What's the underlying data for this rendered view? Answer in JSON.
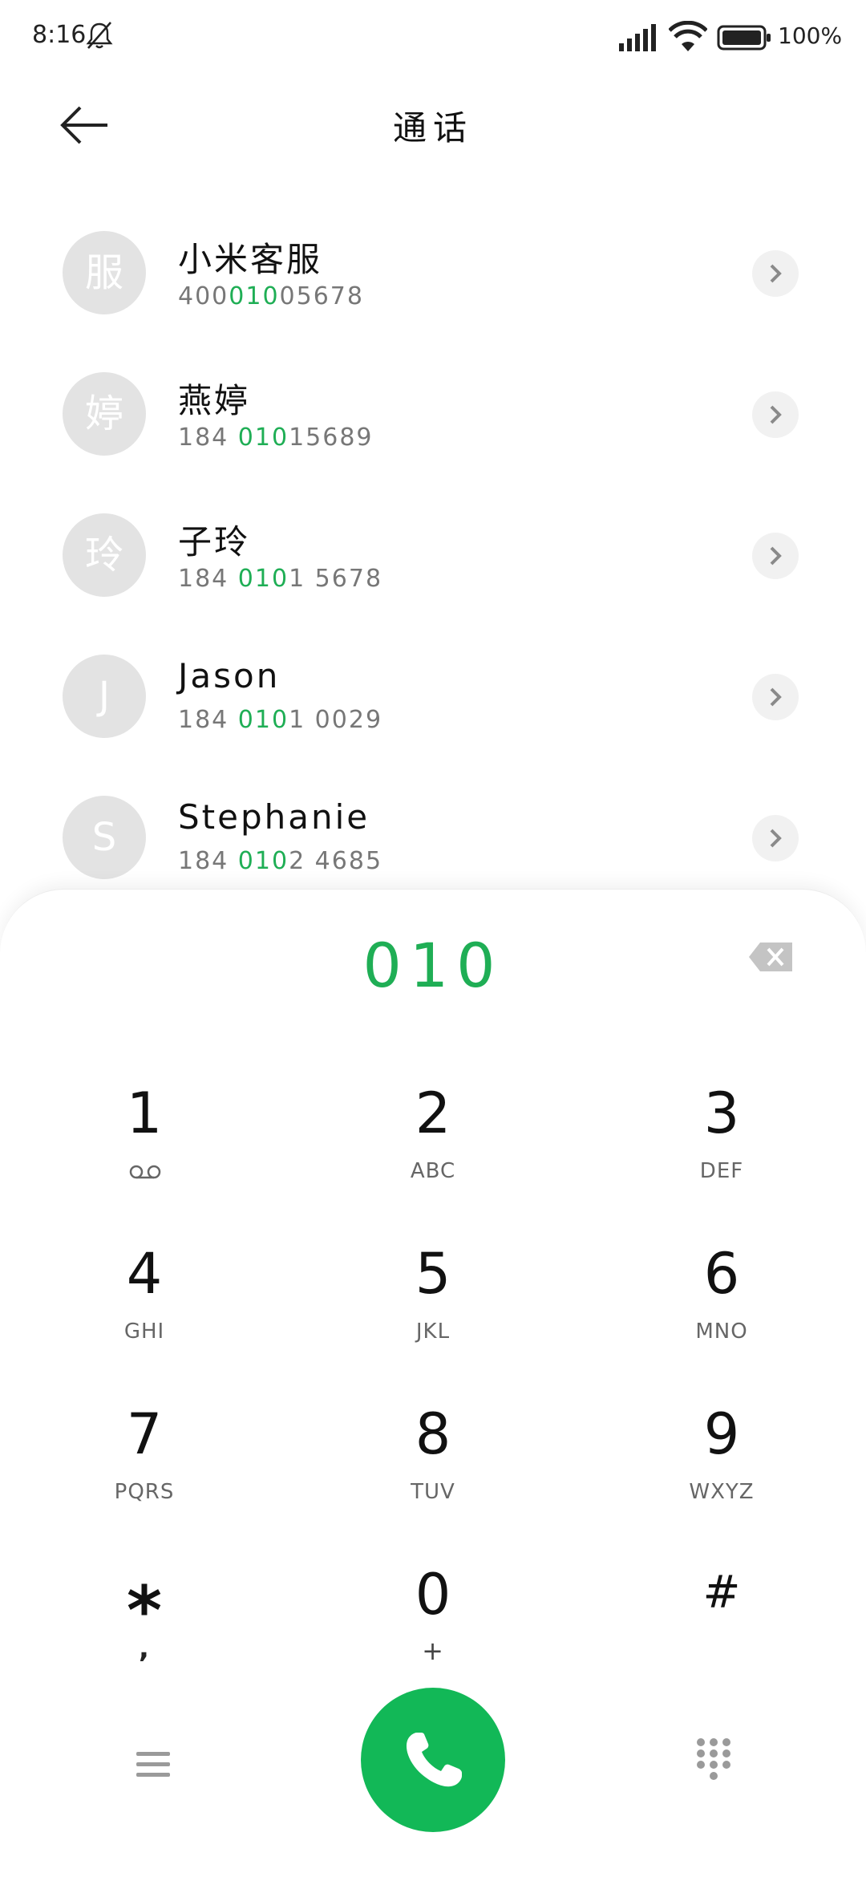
{
  "status_bar": {
    "time": "8:16",
    "battery": "100%"
  },
  "header": {
    "title": "通话"
  },
  "contacts": [
    {
      "avatar": "服",
      "name": "小米客服",
      "number_prefix": "400",
      "number_match": "010",
      "number_suffix": "05678"
    },
    {
      "avatar": "婷",
      "name": "燕婷",
      "number_prefix": "184 ",
      "number_match": "010",
      "number_suffix": "15689"
    },
    {
      "avatar": "玲",
      "name": "子玲",
      "number_prefix": "184 ",
      "number_match": "010",
      "number_suffix": "1 5678"
    },
    {
      "avatar": "J",
      "name": "Jason",
      "number_prefix": "184 ",
      "number_match": "010",
      "number_suffix": "1 0029"
    },
    {
      "avatar": "S",
      "name": "Stephanie",
      "number_prefix": "184 ",
      "number_match": "010",
      "number_suffix": "2 4685"
    }
  ],
  "dialer": {
    "input": "010",
    "keys": [
      {
        "digit": "1",
        "letters": ""
      },
      {
        "digit": "2",
        "letters": "ABC"
      },
      {
        "digit": "3",
        "letters": "DEF"
      },
      {
        "digit": "4",
        "letters": "GHI"
      },
      {
        "digit": "5",
        "letters": "JKL"
      },
      {
        "digit": "6",
        "letters": "MNO"
      },
      {
        "digit": "7",
        "letters": "PQRS"
      },
      {
        "digit": "8",
        "letters": "TUV"
      },
      {
        "digit": "9",
        "letters": "WXYZ"
      },
      {
        "digit": "*",
        "letters": ","
      },
      {
        "digit": "0",
        "letters": "+"
      },
      {
        "digit": "#",
        "letters": ""
      }
    ]
  },
  "icons": {
    "voicemail": "voicemail-icon",
    "call": "phone-icon",
    "menu": "menu-icon",
    "keypad": "keypad-icon"
  },
  "colors": {
    "accent": "#1fae55",
    "call_button": "#12b857"
  }
}
